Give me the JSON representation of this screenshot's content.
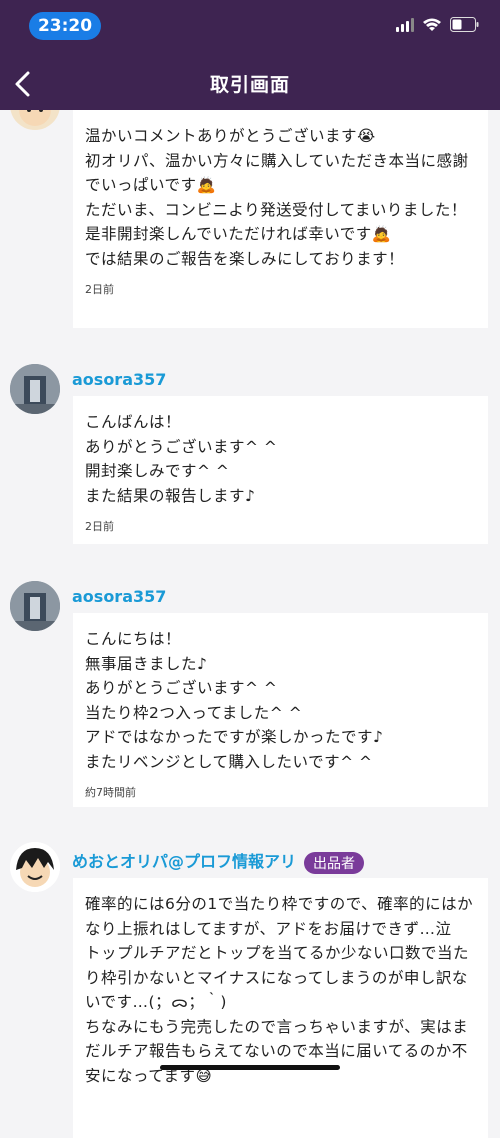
{
  "status_bar": {
    "time": "23:20"
  },
  "header": {
    "title": "取引画面"
  },
  "messages": [
    {
      "text": "温かいコメントありがとうございます😭\n初オリパ、温かい方々に購入していただき本当に感謝でいっぱいです🙇\nただいま、コンビニより発送受付してまいりました！\n是非開封楽しんでいただければ幸いです🙇\nでは結果のご報告を楽しみにしております！",
      "time": "2日前"
    },
    {
      "username": "aosora357",
      "text": "こんばんは！\nありがとうございます^ ^\n開封楽しみです^ ^\nまた結果の報告します♪",
      "time": "2日前"
    },
    {
      "username": "aosora357",
      "text": "こんにちは！\n無事届きました♪\nありがとうございます^ ^\n当たり枠2つ入ってました^ ^\nアドではなかったですが楽しかったです♪\nまたリベンジとして購入したいです^ ^",
      "time": "約7時間前"
    },
    {
      "username": "めおとオリパ@プロフ情報アリ",
      "badge": "出品者",
      "text": "確率的には6分の1で当たり枠ですので、確率的にはかなり上振れはしてますが、アドをお届けできず…泣\nトップルチアだとトップを当てるか少ない口数で当たり枠引かないとマイナスになってしまうのが申し訳ないです…(；ᯅ；｀)\nちなみにもう完売したので言っちゃいますが、実はまだルチア報告もらえてないので本当に届いてるのか不安になってます😅"
    }
  ]
}
